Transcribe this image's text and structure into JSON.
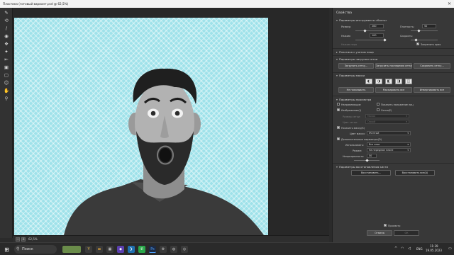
{
  "window": {
    "title": "Пластика (готовый вариант.psd @ 62,5%)"
  },
  "tools": [
    "warp-icon",
    "reconstruct-icon",
    "smooth-icon",
    "twirl-icon",
    "pucker-icon",
    "bloat-icon",
    "push-left-icon",
    "freeze-mask-icon",
    "thaw-mask-icon",
    "face-tool-icon",
    "hand-icon",
    "zoom-icon"
  ],
  "status": {
    "zoom_minus": "−",
    "zoom_plus": "+",
    "zoom": "62,5%"
  },
  "panel": {
    "title": "Свойства",
    "brush": {
      "header": "Параметры инструмента «Кисть»",
      "size_label": "Размер:",
      "size_value": "260",
      "density_label": "Плотность:",
      "density_value": "50",
      "pressure_label": "Нажим:",
      "pressure_value": "100",
      "rate_label": "Скорость:",
      "rate_value": "",
      "stylus_label": "Нажим пера",
      "pin_edges_label": "Закрепить края"
    },
    "face": {
      "header": "Пластика с учетом лица"
    },
    "mesh_load": {
      "header": "Параметры загрузки сетки",
      "load_mesh": "Загрузить сетку…",
      "load_last_mesh": "Загрузить последнюю сетку",
      "save_mesh": "Сохранить сетку…"
    },
    "mask": {
      "header": "Параметры маски",
      "none": "Не показывать",
      "mask_all": "Маскировать все",
      "invert_all": "Инвертировать все"
    },
    "view": {
      "header": "Параметры просмотра",
      "guides": "Направляющие",
      "face_overlay": "Показать наложение лиц",
      "image": "Изображение(I)",
      "mesh": "Сетка(E)",
      "mesh_size_label": "Размер сетки:",
      "mesh_size_value": "Малая",
      "mesh_color_label": "Цвет сетки:",
      "mesh_color_value": "Серый"
    },
    "show_mask": {
      "label": "Показать маску(K)",
      "color_label": "Цвет маски:",
      "color_value": "Желтый"
    },
    "backdrop": {
      "label": "Дополнительные параметры(D)",
      "use_label": "Использовать:",
      "use_value": "Все слои",
      "mode_label": "Режим:",
      "mode_value": "На передним плане",
      "opacity_label": "Непрозрачность:",
      "opacity_value": "50"
    },
    "reconstruct": {
      "header": "Параметры восстановления кисти",
      "reconstruct": "Восстановить…",
      "restore_all": "Восстановить все(A)"
    },
    "preview_label": "Просмотр",
    "cancel": "Отмена",
    "ok": "ОК"
  },
  "taskbar": {
    "search": "Поиск",
    "lang": "ENG",
    "time": "11:39",
    "date": "19.05.2023"
  }
}
